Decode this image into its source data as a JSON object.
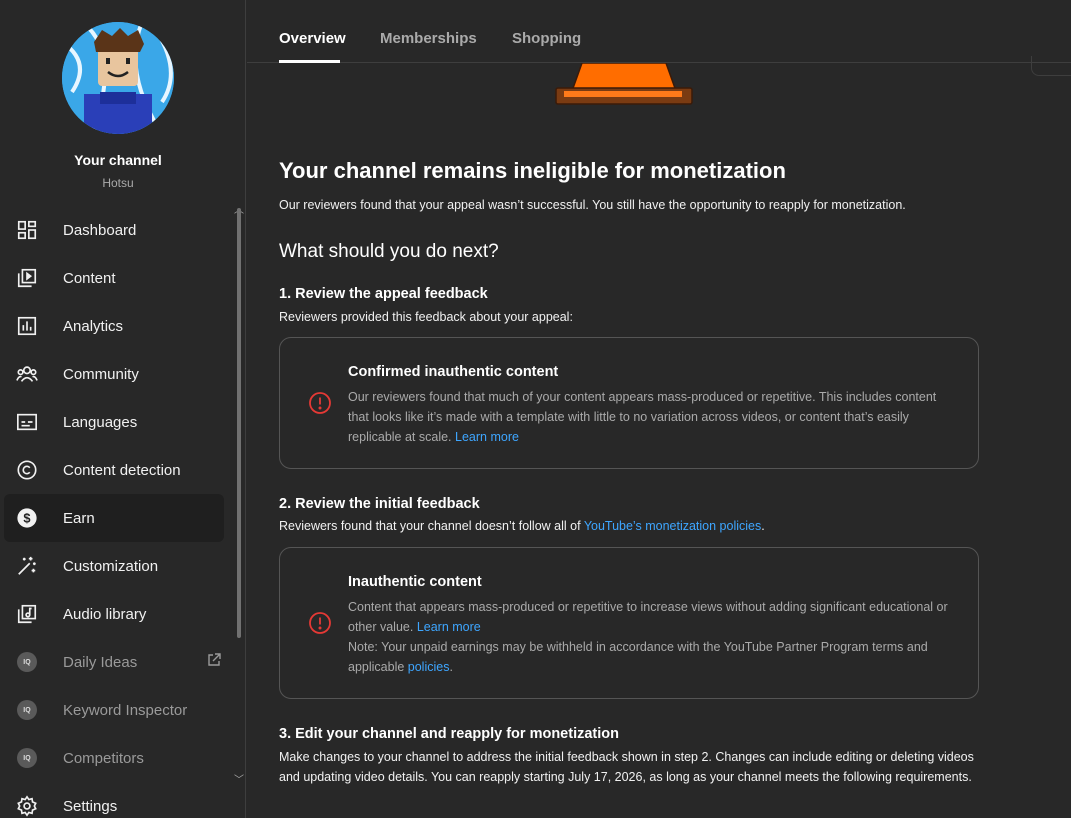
{
  "sidebar": {
    "channel_title": "Your channel",
    "channel_handle": "Hotsu",
    "items": [
      {
        "label": "Dashboard",
        "icon": "dashboard-icon"
      },
      {
        "label": "Content",
        "icon": "content-icon"
      },
      {
        "label": "Analytics",
        "icon": "analytics-icon"
      },
      {
        "label": "Community",
        "icon": "community-icon"
      },
      {
        "label": "Languages",
        "icon": "languages-icon"
      },
      {
        "label": "Content detection",
        "icon": "copyright-icon"
      },
      {
        "label": "Earn",
        "icon": "dollar-icon",
        "active": true
      },
      {
        "label": "Customization",
        "icon": "magic-wand-icon"
      },
      {
        "label": "Audio library",
        "icon": "audio-library-icon"
      },
      {
        "label": "Daily Ideas",
        "icon": "extension-badge-icon",
        "badge": "IQ"
      },
      {
        "label": "Keyword Inspector",
        "icon": "extension-badge-icon",
        "badge": "IQ"
      },
      {
        "label": "Competitors",
        "icon": "extension-badge-icon",
        "badge": "IQ"
      },
      {
        "label": "Settings",
        "icon": "gear-icon"
      }
    ]
  },
  "tabs": [
    {
      "label": "Overview",
      "active": true
    },
    {
      "label": "Memberships"
    },
    {
      "label": "Shopping"
    }
  ],
  "main": {
    "title": "Your channel remains ineligible for monetization",
    "subtitle": "Our reviewers found that your appeal wasn’t successful. You still have the opportunity to reapply for monetization.",
    "next_heading": "What should you do next?",
    "step1": {
      "title": "1. Review the appeal feedback",
      "text": "Reviewers provided this feedback about your appeal:",
      "card": {
        "title": "Confirmed inauthentic content",
        "body": "Our reviewers found that much of your content appears mass-produced or repetitive. This includes content that looks like it’s made with a template with little to no variation across videos, or content that’s easily replicable at scale.",
        "link": "Learn more"
      }
    },
    "step2": {
      "title": "2. Review the initial feedback",
      "text_prefix": "Reviewers found that your channel doesn’t follow all of ",
      "text_link": "YouTube’s monetization policies",
      "text_suffix": ".",
      "card": {
        "title": "Inauthentic content",
        "body": "Content that appears mass-produced or repetitive to increase views without adding significant educational or other value.",
        "link": "Learn more",
        "note_prefix": "Note: Your unpaid earnings may be withheld in accordance with the YouTube Partner Program terms and applicable ",
        "note_link": "policies",
        "note_suffix": "."
      }
    },
    "step3": {
      "title": "3. Edit your channel and reapply for monetization",
      "text": "Make changes to your channel to address the initial feedback shown in step 2. Changes can include editing or deleting videos and updating video details. You can reapply starting July 17, 2026, as long as your channel meets the following requirements."
    }
  },
  "colors": {
    "link": "#3ea6ff",
    "error": "#e53935",
    "cone_orange": "#ff6d00",
    "cone_brown": "#7a3b12"
  }
}
